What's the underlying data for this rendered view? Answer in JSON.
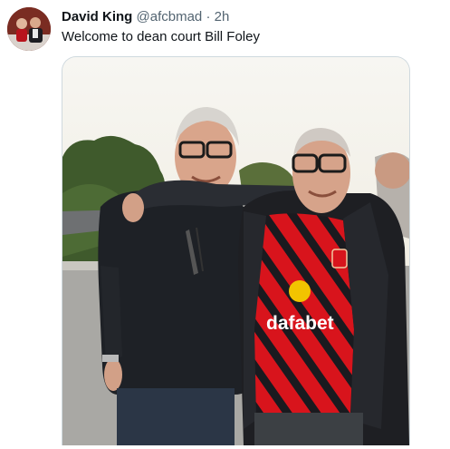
{
  "tweet": {
    "author_name": "David King",
    "handle": "@afcbmad",
    "separator": "·",
    "time": "2h",
    "text": "Welcome to dean court Bill Foley"
  },
  "photo": {
    "jersey_sponsor": "dafabet",
    "sky_color": "#f3f1e8",
    "jersey_red": "#d8141c",
    "jacket_black": "#1e1f23"
  },
  "icons": {
    "avatar": "profile-avatar"
  }
}
